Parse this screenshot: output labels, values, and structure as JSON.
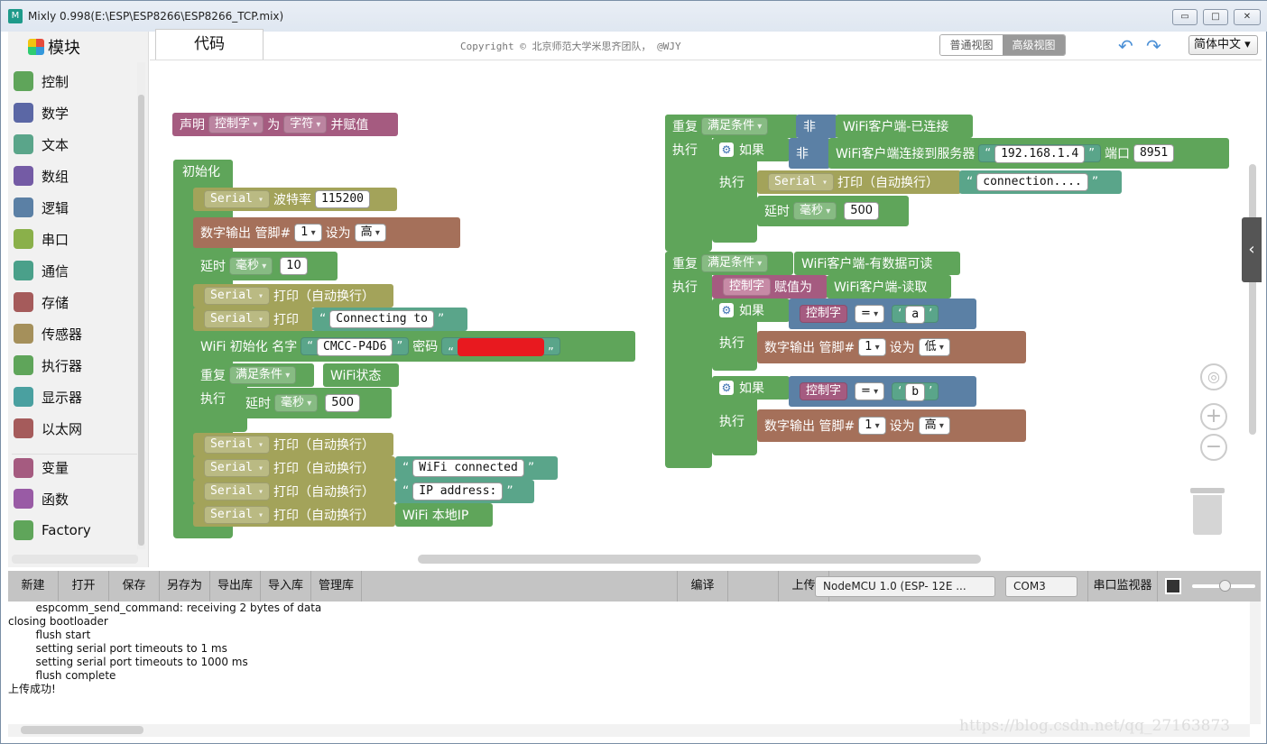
{
  "window": {
    "title": "Mixly 0.998(E:\\ESP\\ESP8266\\ESP8266_TCP.mix)",
    "min": "▭",
    "max": "□",
    "close": "✕"
  },
  "sidebar": {
    "title": "模块",
    "items": [
      {
        "label": "控制",
        "icon": "gamepad-icon",
        "color": "#5fa55a"
      },
      {
        "label": "数学",
        "icon": "math-icon",
        "color": "#5b67a5"
      },
      {
        "label": "文本",
        "icon": "text-icon",
        "color": "#5aa58a"
      },
      {
        "label": "数组",
        "icon": "array-icon",
        "color": "#745ba5"
      },
      {
        "label": "逻辑",
        "icon": "bulb-icon",
        "color": "#5b80a5"
      },
      {
        "label": "串口",
        "icon": "serial-icon",
        "color": "#8ab04a"
      },
      {
        "label": "通信",
        "icon": "comm-icon",
        "color": "#4aa08a"
      },
      {
        "label": "存储",
        "icon": "storage-icon",
        "color": "#a55b5b"
      },
      {
        "label": "传感器",
        "icon": "sensor-icon",
        "color": "#a5905b"
      },
      {
        "label": "执行器",
        "icon": "actuator-icon",
        "color": "#5fa55a"
      },
      {
        "label": "显示器",
        "icon": "display-icon",
        "color": "#4aa0a0"
      },
      {
        "label": "以太网",
        "icon": "ethernet-icon",
        "color": "#a55b5b"
      },
      {
        "label": "变量",
        "icon": "variable-icon",
        "color": "#a55b80"
      },
      {
        "label": "函数",
        "icon": "function-icon",
        "color": "#995ba5"
      },
      {
        "label": "Factory",
        "icon": "factory-icon",
        "color": "#5fa55a"
      }
    ]
  },
  "tabs": {
    "code": "代码",
    "copyright": "Copyright © 北京师范大学米思齐团队， @WJY",
    "normal_view": "普通视图",
    "advanced_view": "高级视图",
    "language": "简体中文 ▾",
    "undo": "↶",
    "redo": "↷"
  },
  "blocks": {
    "declare": [
      "声明",
      "控制字",
      "为",
      "字符",
      "并赋值"
    ],
    "setup": "初始化",
    "serial": "Serial",
    "baud": "波特率",
    "baud_val": "115200",
    "digital_out": "数字输出 管脚#",
    "pin1": "1",
    "set_to": "设为",
    "high": "高",
    "low": "低",
    "delay": "延时",
    "ms": "毫秒",
    "d10": "10",
    "d500": "500",
    "print_ln": "打印（自动换行）",
    "print": "打印",
    "connecting": "Connecting to",
    "wifi_init": "WiFi 初始化 名字",
    "ssid": "CMCC-P4D6",
    "pwd": "密码",
    "repeat": "重复",
    "until": "满足条件",
    "wifi_status": "WiFi状态",
    "do": "执行",
    "wifi_connected": "WiFi connected",
    "ip_addr": "IP address:",
    "local_ip": "WiFi 本地IP",
    "not": "非",
    "client_connected": "WiFi客户端-已连接",
    "if": "如果",
    "client_connect": "WiFi客户端连接到服务器",
    "server": "192.168.1.4",
    "port": "端口",
    "port_val": "8951",
    "connection": "connection....",
    "client_available": "WiFi客户端-有数据可读",
    "assign": "赋值为",
    "client_read": "WiFi客户端-读取",
    "ctrl": "控制字",
    "eq": "=",
    "a": "a",
    "b": "b"
  },
  "toolbar": {
    "new": "新建",
    "open": "打开",
    "save": "保存",
    "save_as": "另存为",
    "export": "导出库",
    "import": "导入库",
    "manage": "管理库",
    "compile": "编译",
    "upload": "上传",
    "board": "NodeMCU 1.0 (ESP- 12E ...",
    "port": "COM3",
    "monitor": "串口监视器"
  },
  "console": [
    "        espcomm_send_command: receiving 2 bytes of data",
    "closing bootloader",
    "        flush start",
    "        setting serial port timeouts to 1 ms",
    "        setting serial port timeouts to 1000 ms",
    "        flush complete",
    "上传成功!"
  ],
  "watermark": "https://blog.csdn.net/qq_27163873"
}
